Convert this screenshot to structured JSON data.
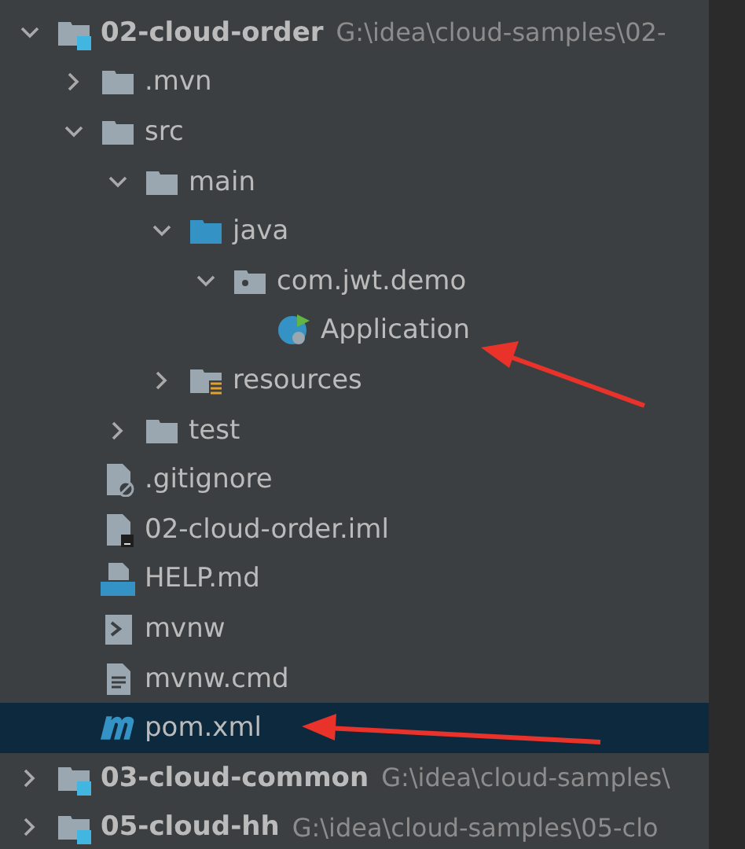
{
  "tree": [
    {
      "kind": "module",
      "name": "02-cloud-order",
      "path": "G:\\idea\\cloud-samples\\02-",
      "expanded": true,
      "selected": false,
      "children": [
        {
          "kind": "folder",
          "name": ".mvn",
          "expanded": false,
          "selected": false
        },
        {
          "kind": "folder",
          "name": "src",
          "expanded": true,
          "selected": false,
          "children": [
            {
              "kind": "folder",
              "name": "main",
              "expanded": true,
              "selected": false,
              "children": [
                {
                  "kind": "source",
                  "name": "java",
                  "expanded": true,
                  "selected": false,
                  "children": [
                    {
                      "kind": "package",
                      "name": "com.jwt.demo",
                      "expanded": true,
                      "selected": false,
                      "children": [
                        {
                          "kind": "app-class",
                          "name": "Application",
                          "selected": false
                        }
                      ]
                    }
                  ]
                },
                {
                  "kind": "resources",
                  "name": "resources",
                  "expanded": false,
                  "selected": false
                }
              ]
            },
            {
              "kind": "folder",
              "name": "test",
              "expanded": false,
              "selected": false
            }
          ]
        },
        {
          "kind": "ignore",
          "name": ".gitignore",
          "selected": false
        },
        {
          "kind": "iml",
          "name": "02-cloud-order.iml",
          "selected": false
        },
        {
          "kind": "md",
          "name": "HELP.md",
          "selected": false
        },
        {
          "kind": "script",
          "name": "mvnw",
          "selected": false
        },
        {
          "kind": "text",
          "name": "mvnw.cmd",
          "selected": false
        },
        {
          "kind": "maven",
          "name": "pom.xml",
          "selected": true
        }
      ]
    },
    {
      "kind": "module",
      "name": "03-cloud-common",
      "path": "G:\\idea\\cloud-samples\\",
      "expanded": false,
      "selected": false
    },
    {
      "kind": "module",
      "name": "05-cloud-hh",
      "path": "G:\\idea\\cloud-samples\\05-clo",
      "expanded": false,
      "selected": false
    }
  ]
}
